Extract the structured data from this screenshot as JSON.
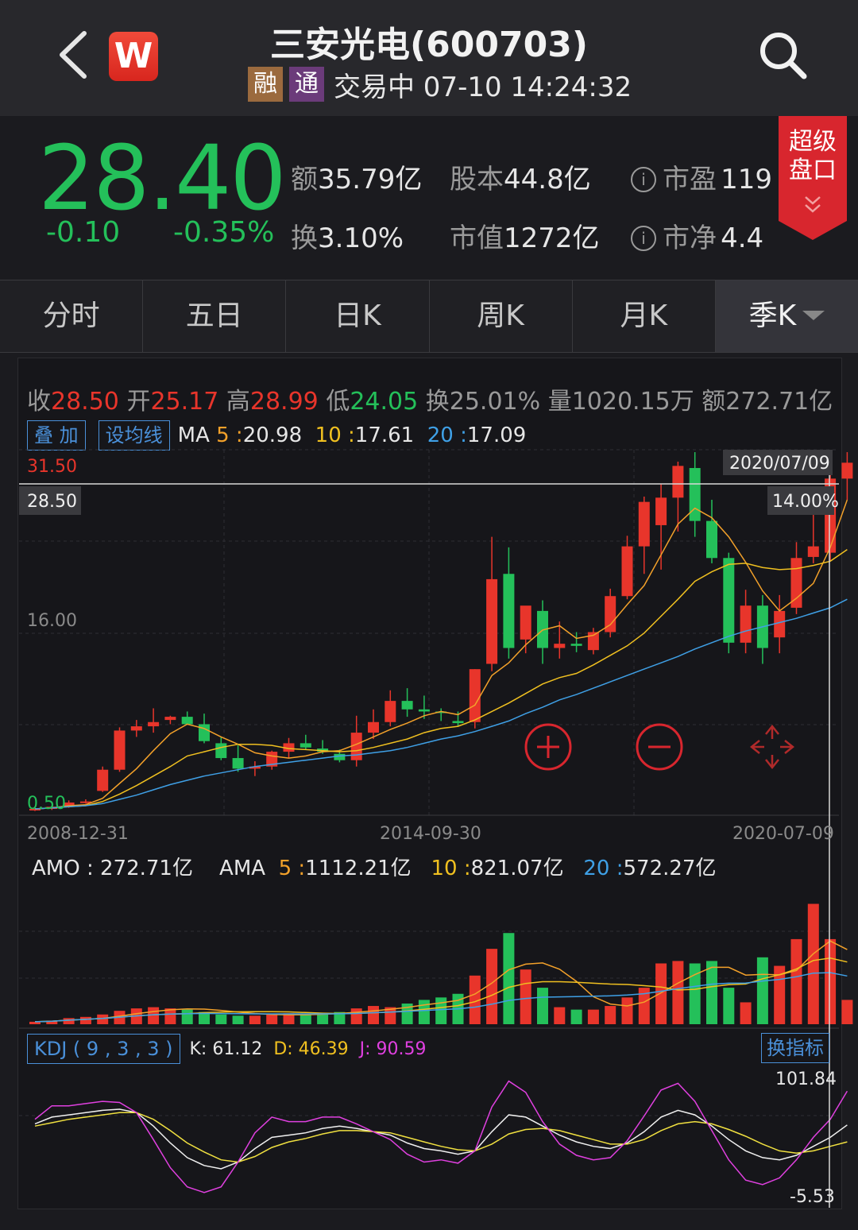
{
  "header": {
    "title": "三安光电(600703)",
    "tag_margin": "融",
    "tag_connect": "通",
    "status": "交易中 07-10 14:24:32"
  },
  "quote": {
    "price": "28.40",
    "change": "-0.10",
    "change_pct": "-0.35%",
    "amount_label": "额",
    "amount_value": "35.79亿",
    "share_label": "股本",
    "share_value": "44.8亿",
    "pe_label": "市盈",
    "pe_value": "119",
    "turnover_label": "换",
    "turnover_value": "3.10%",
    "mcap_label": "市值",
    "mcap_value": "1272亿",
    "pb_label": "市净",
    "pb_value": "4.4",
    "super_panel_line1": "超级",
    "super_panel_line2": "盘口"
  },
  "tabs": [
    "分时",
    "五日",
    "日K",
    "周K",
    "月K",
    "季K"
  ],
  "ohlc": {
    "close_label": "收",
    "close": "28.50",
    "open_label": "开",
    "open": "25.17",
    "high_label": "高",
    "high": "28.99",
    "low_label": "低",
    "low": "24.05",
    "turn_label": "换",
    "turn": "25.01%",
    "vol_label": "量",
    "vol": "1020.15万",
    "amt_label": "额",
    "amt": "272.71亿"
  },
  "ma_row": {
    "overlay_btn": "叠 加",
    "setma_btn": "设均线",
    "ma_label": "MA",
    "ma5_key": "5 :",
    "ma5": "20.98",
    "ma10_key": "10 :",
    "ma10": "17.61",
    "ma20_key": "20 :",
    "ma20": "17.09"
  },
  "main_chart": {
    "ylabels": {
      "top": "31.50",
      "crosshair": "28.50",
      "mid": "16.00",
      "bottom": "0.50"
    },
    "crosshair_date": "2020/07/09",
    "crosshair_pct": "14.00%",
    "xlabels": [
      "2008-12-31",
      "2014-09-30",
      "2020-07-09"
    ]
  },
  "amo_row": {
    "amo_label": "AMO :",
    "amo": "272.71亿",
    "ama_label": "AMA",
    "ama5_key": "5 :",
    "ama5": "1112.21亿",
    "ama10_key": "10 :",
    "ama10": "821.07亿",
    "ama20_key": "20 :",
    "ama20": "572.27亿"
  },
  "kdj_row": {
    "label": "KDJ ( 9 , 3 , 3 )",
    "k": "K: 61.12",
    "d": "D: 46.39",
    "j": "J: 90.59",
    "swap_btn": "换指标",
    "ymax": "101.84",
    "ymin": "-5.53"
  },
  "colors": {
    "up": "#e8352b",
    "down": "#24c05a",
    "ma5": "#f3a12a",
    "ma10": "#f0c020",
    "ma20": "#3fa0e6"
  },
  "chart_data": {
    "type": "candlestick",
    "period": "quarterly",
    "ylim": [
      0.5,
      31.5
    ],
    "candles": [
      {
        "o": 0.7,
        "h": 0.9,
        "l": 0.6,
        "c": 0.8
      },
      {
        "o": 0.8,
        "h": 1.1,
        "l": 0.7,
        "c": 1.0
      },
      {
        "o": 1.0,
        "h": 1.6,
        "l": 0.9,
        "c": 1.4
      },
      {
        "o": 1.4,
        "h": 1.7,
        "l": 1.3,
        "c": 1.5
      },
      {
        "o": 2.5,
        "h": 4.8,
        "l": 2.4,
        "c": 4.5
      },
      {
        "o": 4.5,
        "h": 8.5,
        "l": 4.3,
        "c": 8.2
      },
      {
        "o": 8.2,
        "h": 9.2,
        "l": 7.6,
        "c": 8.6
      },
      {
        "o": 8.6,
        "h": 10.3,
        "l": 8.0,
        "c": 9.0
      },
      {
        "o": 9.2,
        "h": 9.6,
        "l": 8.8,
        "c": 9.5
      },
      {
        "o": 9.5,
        "h": 10.0,
        "l": 8.8,
        "c": 8.8
      },
      {
        "o": 8.8,
        "h": 9.8,
        "l": 7.0,
        "c": 7.2
      },
      {
        "o": 7.0,
        "h": 7.6,
        "l": 5.4,
        "c": 5.6
      },
      {
        "o": 5.6,
        "h": 6.8,
        "l": 4.3,
        "c": 4.6
      },
      {
        "o": 4.6,
        "h": 5.3,
        "l": 3.9,
        "c": 4.8
      },
      {
        "o": 4.8,
        "h": 6.3,
        "l": 4.5,
        "c": 6.2
      },
      {
        "o": 6.2,
        "h": 7.5,
        "l": 5.6,
        "c": 7.0
      },
      {
        "o": 7.0,
        "h": 7.8,
        "l": 6.4,
        "c": 6.6
      },
      {
        "o": 6.5,
        "h": 7.3,
        "l": 6.0,
        "c": 6.2
      },
      {
        "o": 6.0,
        "h": 6.4,
        "l": 5.2,
        "c": 5.4
      },
      {
        "o": 5.4,
        "h": 9.6,
        "l": 4.8,
        "c": 8.0
      },
      {
        "o": 8.0,
        "h": 10.2,
        "l": 7.4,
        "c": 9.0
      },
      {
        "o": 9.0,
        "h": 12.0,
        "l": 8.6,
        "c": 11.0
      },
      {
        "o": 11.0,
        "h": 12.2,
        "l": 9.5,
        "c": 10.2
      },
      {
        "o": 10.2,
        "h": 11.5,
        "l": 9.3,
        "c": 10.0
      },
      {
        "o": 10.0,
        "h": 10.3,
        "l": 9.1,
        "c": 9.9
      },
      {
        "o": 9.1,
        "h": 10.0,
        "l": 8.6,
        "c": 8.9
      },
      {
        "o": 9.0,
        "h": 14.0,
        "l": 8.4,
        "c": 14.0
      },
      {
        "o": 14.5,
        "h": 26.5,
        "l": 13.8,
        "c": 22.5
      },
      {
        "o": 23.0,
        "h": 25.5,
        "l": 15.0,
        "c": 16.0
      },
      {
        "o": 16.8,
        "h": 19.5,
        "l": 15.5,
        "c": 20.0
      },
      {
        "o": 19.5,
        "h": 20.5,
        "l": 14.5,
        "c": 16.0
      },
      {
        "o": 16.0,
        "h": 18.5,
        "l": 15.0,
        "c": 16.4
      },
      {
        "o": 16.4,
        "h": 17.5,
        "l": 15.6,
        "c": 16.2
      },
      {
        "o": 15.8,
        "h": 17.9,
        "l": 15.4,
        "c": 17.5
      },
      {
        "o": 17.5,
        "h": 21.6,
        "l": 17.0,
        "c": 20.9
      },
      {
        "o": 20.9,
        "h": 26.6,
        "l": 20.6,
        "c": 25.6
      },
      {
        "o": 25.6,
        "h": 30.3,
        "l": 23.0,
        "c": 29.8
      },
      {
        "o": 27.6,
        "h": 31.5,
        "l": 23.4,
        "c": 30.2
      },
      {
        "o": 30.2,
        "h": 33.6,
        "l": 27.0,
        "c": 33.2
      },
      {
        "o": 33.0,
        "h": 34.5,
        "l": 26.5,
        "c": 28.0
      },
      {
        "o": 28.0,
        "h": 30.0,
        "l": 24.0,
        "c": 24.5
      },
      {
        "o": 24.5,
        "h": 25.0,
        "l": 15.5,
        "c": 16.5
      },
      {
        "o": 16.5,
        "h": 21.5,
        "l": 15.5,
        "c": 20.0
      },
      {
        "o": 20.0,
        "h": 21.0,
        "l": 14.5,
        "c": 16.0
      },
      {
        "o": 17.0,
        "h": 21.0,
        "l": 15.5,
        "c": 19.5
      },
      {
        "o": 19.8,
        "h": 26.0,
        "l": 19.2,
        "c": 24.5
      },
      {
        "o": 24.6,
        "h": 29.5,
        "l": 24.0,
        "c": 25.6
      },
      {
        "o": 25.0,
        "h": 32.5,
        "l": 24.2,
        "c": 32.0
      },
      {
        "o": 32.0,
        "h": 34.5,
        "l": 30.0,
        "c": 33.5
      }
    ],
    "ma5": [
      0.8,
      0.9,
      1.1,
      1.2,
      1.8,
      3.2,
      4.6,
      6.3,
      7.9,
      8.8,
      8.4,
      7.6,
      6.9,
      6.1,
      5.8,
      5.6,
      5.8,
      6.2,
      6.3,
      6.9,
      7.6,
      8.3,
      8.9,
      9.6,
      10.0,
      9.7,
      10.6,
      13.4,
      14.6,
      16.3,
      17.7,
      18.1,
      16.9,
      17.2,
      18.2,
      20.1,
      21.9,
      24.8,
      27.7,
      29.2,
      28.3,
      26.5,
      24.1,
      21.4,
      19.5,
      20.7,
      22.1,
      25.5,
      30.0
    ],
    "ma10": [
      0.8,
      0.9,
      1.0,
      1.1,
      1.5,
      2.2,
      3.0,
      3.9,
      4.8,
      5.8,
      6.2,
      6.6,
      6.9,
      6.9,
      6.8,
      6.5,
      6.4,
      6.3,
      6.2,
      6.3,
      6.6,
      7.0,
      7.4,
      8.0,
      8.4,
      8.6,
      9.2,
      10.0,
      10.8,
      11.7,
      12.6,
      13.2,
      13.6,
      14.4,
      15.3,
      16.2,
      17.4,
      19.0,
      20.6,
      22.3,
      23.2,
      23.9,
      24.0,
      23.6,
      23.4,
      23.5,
      23.8,
      24.2,
      25.3
    ],
    "ma20": [
      0.8,
      0.9,
      1.0,
      1.1,
      1.3,
      1.7,
      2.1,
      2.6,
      3.1,
      3.5,
      3.9,
      4.2,
      4.5,
      4.8,
      5.0,
      5.2,
      5.4,
      5.6,
      5.8,
      5.9,
      6.1,
      6.3,
      6.6,
      7.0,
      7.4,
      7.7,
      8.1,
      8.6,
      9.1,
      9.8,
      10.4,
      11.1,
      11.6,
      12.2,
      12.8,
      13.4,
      14.0,
      14.6,
      15.2,
      15.9,
      16.5,
      17.1,
      17.6,
      18.0,
      18.4,
      18.8,
      19.3,
      19.8,
      20.6
    ],
    "volume": [
      2,
      3,
      5,
      6,
      8,
      11,
      13,
      14,
      13,
      12,
      10,
      8,
      7,
      7,
      8,
      9,
      8,
      9,
      10,
      13,
      15,
      14,
      17,
      20,
      22,
      25,
      40,
      62,
      75,
      45,
      30,
      14,
      12,
      12,
      15,
      22,
      30,
      50,
      52,
      50,
      52,
      30,
      18,
      55,
      48,
      70,
      99,
      70,
      20
    ],
    "kdj": {
      "k": [
        62,
        68,
        70,
        72,
        74,
        75,
        72,
        60,
        45,
        32,
        25,
        22,
        28,
        40,
        50,
        52,
        54,
        58,
        60,
        58,
        55,
        52,
        45,
        40,
        38,
        35,
        38,
        55,
        70,
        68,
        60,
        52,
        46,
        42,
        40,
        45,
        55,
        68,
        74,
        70,
        60,
        48,
        38,
        32,
        30,
        34,
        42,
        50,
        61
      ],
      "d": [
        60,
        63,
        66,
        68,
        70,
        72,
        72,
        66,
        56,
        45,
        37,
        30,
        28,
        33,
        41,
        46,
        49,
        53,
        56,
        56,
        55,
        54,
        50,
        46,
        42,
        39,
        38,
        44,
        53,
        57,
        58,
        56,
        52,
        48,
        44,
        44,
        48,
        56,
        62,
        64,
        62,
        57,
        51,
        44,
        38,
        36,
        38,
        42,
        46
      ],
      "j": [
        66,
        78,
        78,
        80,
        82,
        81,
        72,
        48,
        23,
        6,
        1,
        6,
        28,
        54,
        68,
        64,
        64,
        68,
        68,
        62,
        55,
        48,
        35,
        28,
        30,
        27,
        38,
        77,
        100,
        90,
        64,
        44,
        34,
        30,
        32,
        47,
        69,
        92,
        98,
        82,
        56,
        30,
        12,
        8,
        14,
        30,
        50,
        66,
        91
      ]
    }
  }
}
